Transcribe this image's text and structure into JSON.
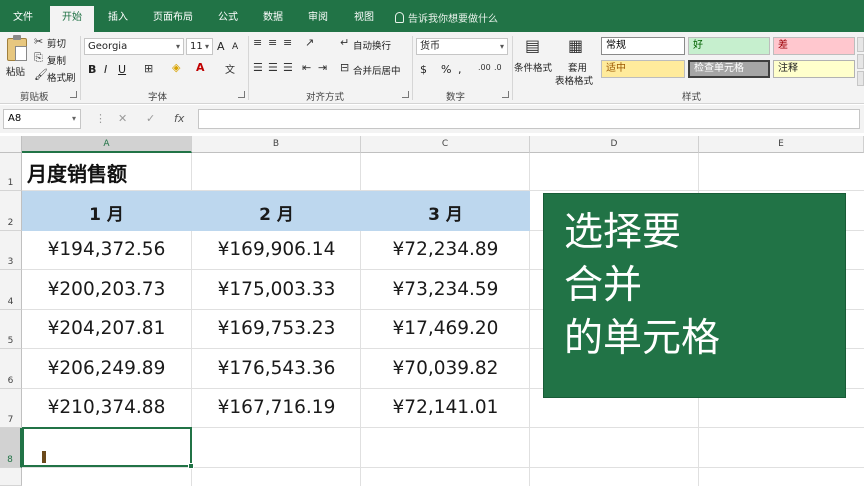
{
  "tabs": [
    "文件",
    "开始",
    "插入",
    "页面布局",
    "公式",
    "数据",
    "审阅",
    "视图"
  ],
  "tell_me": "告诉我你想要做什么",
  "clipboard": {
    "paste": "粘贴",
    "cut": "剪切",
    "copy": "复制",
    "format_painter": "格式刷",
    "group": "剪贴板"
  },
  "font": {
    "name": "Georgia",
    "size": "11",
    "bold": "B",
    "italic": "I",
    "underline": "U",
    "grow": "A",
    "shrink": "A",
    "group": "字体"
  },
  "alignment": {
    "wrap": "自动换行",
    "merge": "合并后居中",
    "group": "对齐方式"
  },
  "number": {
    "format": "货币",
    "currency": "$",
    "percent": "%",
    "comma": ",",
    "group": "数字"
  },
  "styles": {
    "conditional": "条件格式",
    "table_format_1": "套用",
    "table_format_2": "表格格式",
    "normal": "常规",
    "good": "好",
    "bad": "差",
    "neutral": "适中",
    "check_cell": "检查单元格",
    "note": "注释",
    "group": "样式"
  },
  "colors": {
    "accent": "#217346",
    "good_bg": "#c6efce",
    "good_fg": "#006100",
    "bad_bg": "#ffc7ce",
    "bad_fg": "#9c0006",
    "neutral_bg": "#ffeb9c",
    "neutral_fg": "#9c5700",
    "check_bg": "#a5a5a5",
    "header_band": "#bdd7ee"
  },
  "formula_bar": {
    "name_box": "A8",
    "cancel": "✕",
    "enter": "✓",
    "fx": "fx",
    "value": ""
  },
  "columns": [
    "A",
    "B",
    "C",
    "D",
    "E"
  ],
  "rows": [
    "1",
    "2",
    "3",
    "4",
    "5",
    "6",
    "7",
    "8"
  ],
  "sheet": {
    "title": "月度销售额",
    "headers": [
      "1 月",
      "2 月",
      "3 月"
    ],
    "data": [
      [
        "¥194,372.56",
        "¥169,906.14",
        "¥72,234.89"
      ],
      [
        "¥200,203.73",
        "¥175,003.33",
        "¥73,234.59"
      ],
      [
        "¥204,207.81",
        "¥169,753.23",
        "¥17,469.20"
      ],
      [
        "¥206,249.89",
        "¥176,543.36",
        "¥70,039.82"
      ],
      [
        "¥210,374.88",
        "¥167,716.19",
        "¥72,141.01"
      ]
    ]
  },
  "callout": [
    "选择要",
    "合并",
    "的单元格"
  ]
}
